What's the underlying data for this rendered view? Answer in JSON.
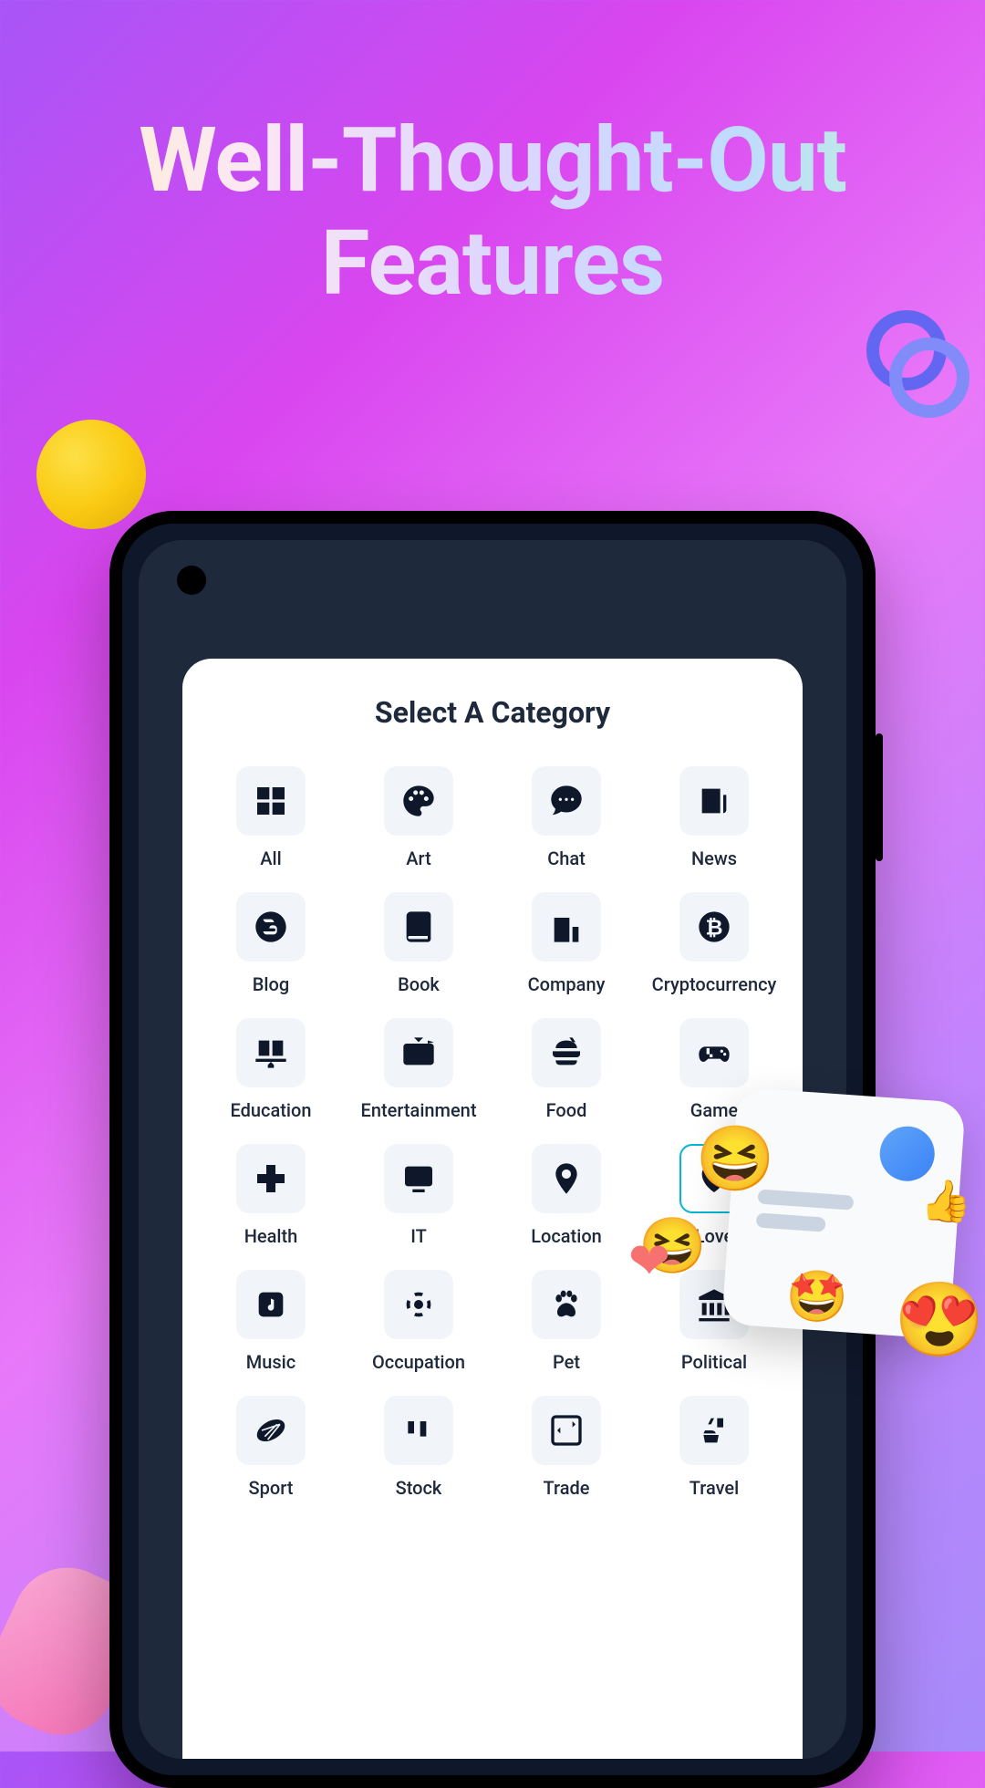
{
  "headline": {
    "line1": "Well-Thought-Out",
    "line2": "Features"
  },
  "modal": {
    "title": "Select A Category"
  },
  "categories": [
    {
      "label": "All",
      "icon": "grid-icon",
      "selected": false
    },
    {
      "label": "Art",
      "icon": "palette-icon",
      "selected": false
    },
    {
      "label": "Chat",
      "icon": "chat-icon",
      "selected": false
    },
    {
      "label": "News",
      "icon": "newspaper-icon",
      "selected": false
    },
    {
      "label": "Blog",
      "icon": "blogger-icon",
      "selected": false
    },
    {
      "label": "Book",
      "icon": "book-icon",
      "selected": false
    },
    {
      "label": "Company",
      "icon": "building-icon",
      "selected": false
    },
    {
      "label": "Cryptocurrency",
      "icon": "bitcoin-icon",
      "selected": false
    },
    {
      "label": "Education",
      "icon": "education-icon",
      "selected": false
    },
    {
      "label": "Entertainment",
      "icon": "tv-icon",
      "selected": false
    },
    {
      "label": "Food",
      "icon": "food-icon",
      "selected": false
    },
    {
      "label": "Game",
      "icon": "gamepad-icon",
      "selected": false
    },
    {
      "label": "Health",
      "icon": "health-icon",
      "selected": false
    },
    {
      "label": "IT",
      "icon": "monitor-icon",
      "selected": false
    },
    {
      "label": "Location",
      "icon": "location-icon",
      "selected": false
    },
    {
      "label": "Love",
      "icon": "heart-icon",
      "selected": true
    },
    {
      "label": "Music",
      "icon": "music-icon",
      "selected": false
    },
    {
      "label": "Occupation",
      "icon": "occupation-icon",
      "selected": false
    },
    {
      "label": "Pet",
      "icon": "paw-icon",
      "selected": false
    },
    {
      "label": "Political",
      "icon": "political-icon",
      "selected": false
    },
    {
      "label": "Sport",
      "icon": "sport-icon",
      "selected": false
    },
    {
      "label": "Stock",
      "icon": "stock-icon",
      "selected": false
    },
    {
      "label": "Trade",
      "icon": "trade-icon",
      "selected": false
    },
    {
      "label": "Travel",
      "icon": "travel-icon",
      "selected": false
    }
  ],
  "icons": {
    "grid-icon": "▦",
    "palette-icon": "🎨",
    "chat-icon": "💬",
    "newspaper-icon": "📰",
    "blogger-icon": "B",
    "book-icon": "📕",
    "building-icon": "🏢",
    "bitcoin-icon": "₿",
    "education-icon": "🎓",
    "tv-icon": "📺",
    "food-icon": "🍔",
    "gamepad-icon": "🎮",
    "health-icon": "✚",
    "monitor-icon": "■",
    "location-icon": "●",
    "heart-icon": "♥",
    "music-icon": "♪",
    "occupation-icon": "◉",
    "paw-icon": "🐾",
    "political-icon": "🏛",
    "sport-icon": "🏈",
    "stock-icon": "⇅",
    "trade-icon": "⇄",
    "travel-icon": "✈"
  }
}
